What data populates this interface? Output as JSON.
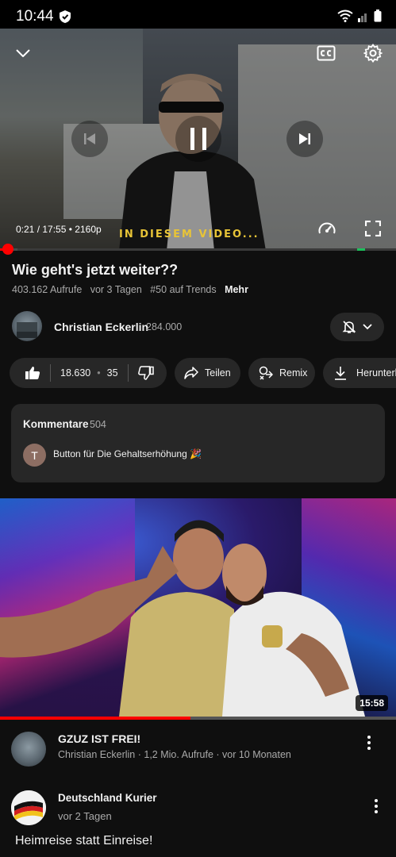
{
  "status_bar": {
    "time": "10:44"
  },
  "player": {
    "time_current": "0:21",
    "time_total": "17:55",
    "quality": "2160p",
    "burned_caption": "IN DIESEM VIDEO...",
    "progress_fraction": 0.0195,
    "buffer_fraction": 0.045
  },
  "video": {
    "title": "Wie geht's jetzt weiter??",
    "views": "403.162 Aufrufe",
    "age": "vor 3 Tagen",
    "trend": "#50 auf Trends",
    "more": "Mehr"
  },
  "channel": {
    "name": "Christian Eckerlin",
    "subscribers": "284.000"
  },
  "actions": {
    "likes": "18.630",
    "dislikes": "35",
    "share": "Teilen",
    "remix": "Remix",
    "download": "Herunterl"
  },
  "comments": {
    "heading": "Kommentare",
    "count": "504",
    "top_avatar_letter": "T",
    "top_comment": "Button für Die Gehaltserhöhung 🎉"
  },
  "next_video": {
    "duration": "15:58",
    "watched_fraction": 0.48,
    "title": "GZUZ IST FREI!",
    "meta": "Christian Eckerlin · 1,2 Mio. Aufrufe · vor 10 Monaten"
  },
  "post": {
    "channel": "Deutschland Kurier",
    "age": "vor 2 Tagen",
    "text": "Heimreise statt Einreise!"
  },
  "colors": {
    "accent": "#ff0000",
    "background": "#0f0f0f",
    "surface": "#272727"
  },
  "icons": [
    "shield-vpn-icon",
    "wifi-icon",
    "signal-icon",
    "battery-icon",
    "chevron-down-icon",
    "closed-captions-icon",
    "settings-gear-icon",
    "previous-icon",
    "pause-icon",
    "next-icon",
    "playback-speed-icon",
    "fullscreen-icon",
    "bell-off-icon",
    "thumbs-up-icon",
    "thumbs-down-icon",
    "share-icon",
    "remix-icon",
    "download-icon",
    "more-vert-icon"
  ]
}
